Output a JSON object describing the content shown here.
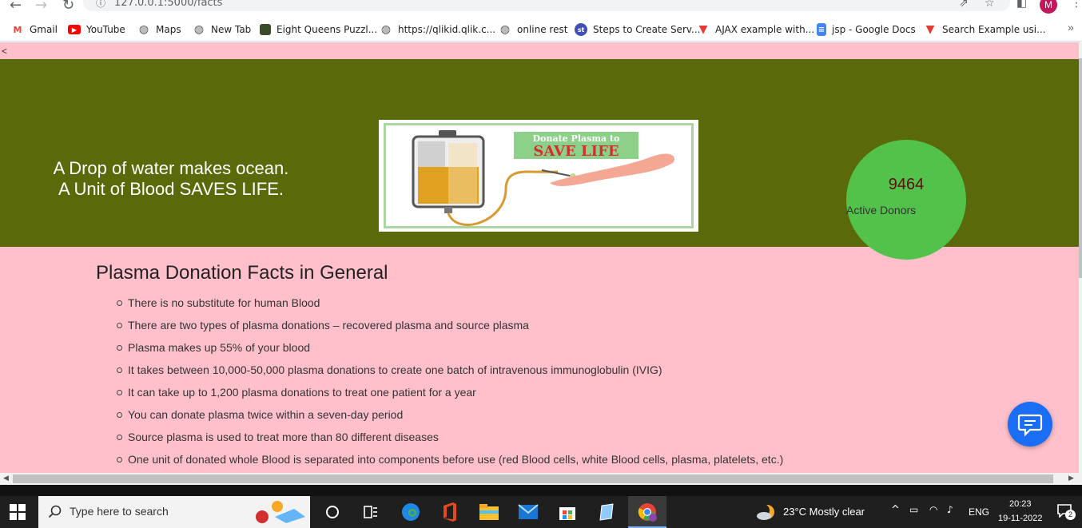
{
  "browser": {
    "url": "127.0.0.1:5000/facts",
    "profile_initial": "M",
    "bookmarks": [
      {
        "label": "Gmail",
        "icon": "gmail-icon"
      },
      {
        "label": "YouTube",
        "icon": "youtube-icon"
      },
      {
        "label": "Maps",
        "icon": "globe-icon"
      },
      {
        "label": "New Tab",
        "icon": "globe-icon"
      },
      {
        "label": "Eight Queens Puzzl...",
        "icon": "puzzle-image-icon"
      },
      {
        "label": "https://qlikid.qlik.c...",
        "icon": "globe-icon"
      },
      {
        "label": "online rest",
        "icon": "globe-icon"
      },
      {
        "label": "Steps to Create Serv...",
        "icon": "st-icon"
      },
      {
        "label": "AJAX example with...",
        "icon": "red-v-icon"
      },
      {
        "label": "jsp - Google Docs",
        "icon": "google-docs-icon"
      },
      {
        "label": "Search Example usi...",
        "icon": "red-v-icon"
      }
    ],
    "more_bookmarks": "»"
  },
  "page": {
    "back_link": "<",
    "tagline_line1": "A Drop of water makes ocean.",
    "tagline_line2": "A Unit of Blood SAVES LIFE.",
    "banner_line1": "Donate Plasma to",
    "banner_line2": "SAVE LIFE",
    "donor_count": "9464",
    "donor_label": "Active Donors",
    "facts_title": "Plasma Donation Facts in General",
    "facts": [
      "There is no substitute for human Blood",
      "There are two types of plasma donations – recovered plasma and source plasma",
      "Plasma makes up 55% of your blood",
      "It takes between 10,000-50,000 plasma donations to create one batch of intravenous immunoglobulin (IVIG)",
      "It can take up to 1,200 plasma donations to treat one patient for a year",
      "You can donate plasma twice within a seven-day period",
      "Source plasma is used to treat more than 80 different diseases",
      "One unit of donated whole Blood is separated into components before use (red Blood cells, white Blood cells, plasma, platelets, etc.)"
    ]
  },
  "taskbar": {
    "search_placeholder": "Type here to search",
    "weather": "23°C  Mostly clear",
    "language": "ENG",
    "time": "20:23",
    "date": "19-11-2022",
    "notification_count": "2"
  },
  "colors": {
    "page_bg": "#ffc0cb",
    "hero_bg": "#5a6a0a",
    "donor_circle": "#52c24a",
    "chat_button": "#1a6df5"
  }
}
